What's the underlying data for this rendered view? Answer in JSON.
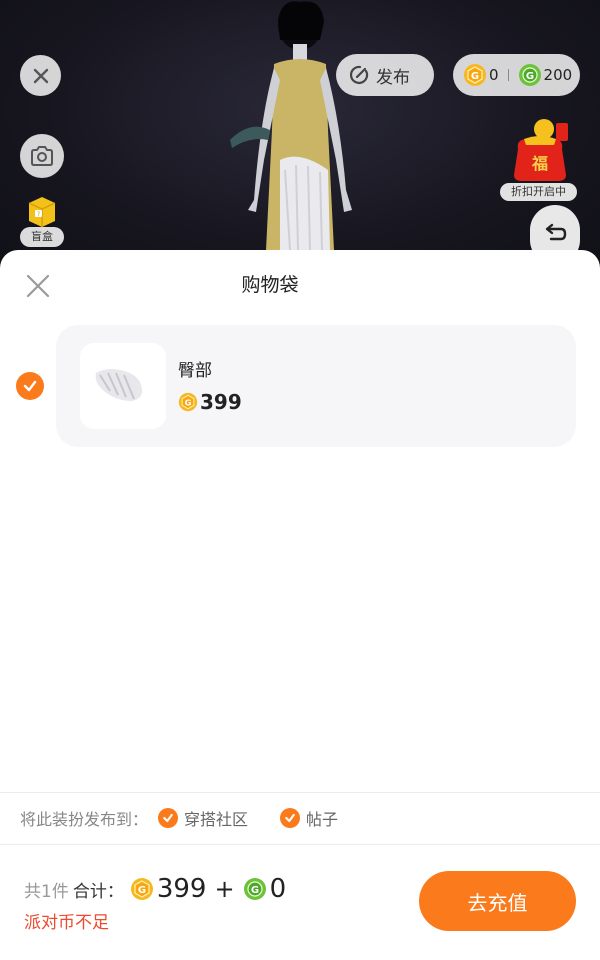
{
  "top_bar": {
    "publish_label": "发布",
    "gold_coin_count": "0",
    "green_coin_count": "200",
    "blind_box_label": "盲盒",
    "promo_label": "折扣开启中"
  },
  "sheet": {
    "title": "购物袋",
    "items": [
      {
        "name": "臀部",
        "price": "399",
        "selected": true
      }
    ],
    "share": {
      "label": "将此装扮发布到：",
      "options": [
        "穿搭社区",
        "帖子"
      ]
    },
    "summary": {
      "count_text": "共1件",
      "total_label": "合计：",
      "gold_total": "399",
      "plus": "+",
      "green_total": "0",
      "warning": "派对币不足"
    },
    "recharge_label": "去充值"
  },
  "colors": {
    "accent": "#fb7a1c",
    "warning": "#ee4a2e",
    "gold_coin": "#f5b820",
    "green_coin": "#6cc23a"
  },
  "icons": [
    "close-icon",
    "camera-icon",
    "publish-icon",
    "gold-coin-icon",
    "green-coin-icon",
    "blind-box-icon",
    "lucky-bag-icon",
    "undo-icon",
    "check-icon"
  ]
}
